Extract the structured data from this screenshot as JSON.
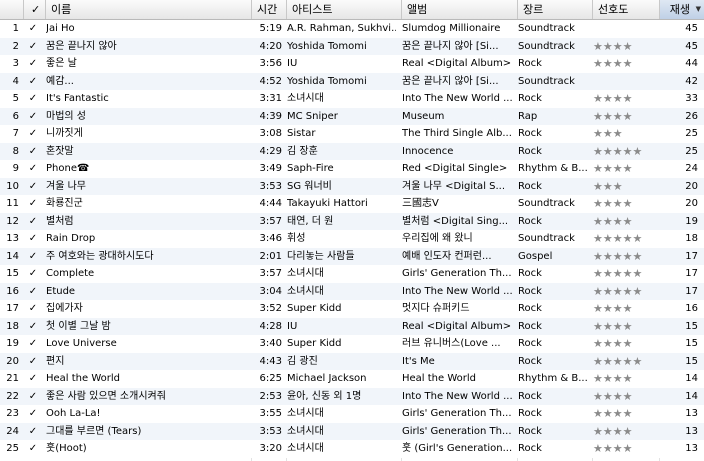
{
  "header": {
    "check": "✓",
    "name": "이름",
    "time": "시간",
    "artist": "아티스트",
    "album": "앨범",
    "genre": "장르",
    "rating": "선호도",
    "plays": "재생",
    "sort_arrow": "▼"
  },
  "check_glyph": "✓",
  "tracks": [
    {
      "num": "1",
      "name": "Jai Ho",
      "time": "5:19",
      "artist": "A.R. Rahman, Sukhvi...",
      "album": "Slumdog Millionaire",
      "genre": "Soundtrack",
      "rating": "",
      "plays": "45"
    },
    {
      "num": "2",
      "name": "꿈은 끝나지 않아",
      "time": "4:20",
      "artist": "Yoshida Tomomi",
      "album": "꿈은 끝나지 않아 [Si...",
      "genre": "Soundtrack",
      "rating": "★★★★",
      "plays": "45"
    },
    {
      "num": "3",
      "name": "좋은 날",
      "time": "3:56",
      "artist": "IU",
      "album": "Real <Digital Album>",
      "genre": "Rock",
      "rating": "★★★★",
      "plays": "44"
    },
    {
      "num": "4",
      "name": "예감...",
      "time": "4:52",
      "artist": "Yoshida Tomomi",
      "album": "꿈은 끝나지 않아 [Si...",
      "genre": "Soundtrack",
      "rating": "",
      "plays": "42"
    },
    {
      "num": "5",
      "name": "It's Fantastic",
      "time": "3:31",
      "artist": "소녀시대",
      "album": "Into The New World ...",
      "genre": "Rock",
      "rating": "★★★★",
      "plays": "33"
    },
    {
      "num": "6",
      "name": "마법의 성",
      "time": "4:39",
      "artist": "MC Sniper",
      "album": "Museum",
      "genre": "Rap",
      "rating": "★★★★",
      "plays": "26"
    },
    {
      "num": "7",
      "name": "니까짓게",
      "time": "3:08",
      "artist": "Sistar",
      "album": "The Third Single Alb...",
      "genre": "Rock",
      "rating": "★★★",
      "plays": "25"
    },
    {
      "num": "8",
      "name": "혼잣말",
      "time": "4:29",
      "artist": "김 장훈",
      "album": "Innocence",
      "genre": "Rock",
      "rating": "★★★★★",
      "plays": "25"
    },
    {
      "num": "9",
      "name": "Phone☎",
      "time": "3:49",
      "artist": "Saph-Fire",
      "album": "Red <Digital Single>",
      "genre": "Rhythm & B...",
      "rating": "★★★★",
      "plays": "24"
    },
    {
      "num": "10",
      "name": "겨울 나무",
      "time": "3:53",
      "artist": "SG 워너비",
      "album": "겨울 나무 <Digital S...",
      "genre": "Rock",
      "rating": "★★★",
      "plays": "20"
    },
    {
      "num": "11",
      "name": "화룡진군",
      "time": "4:44",
      "artist": "Takayuki Hattori",
      "album": "三國志V",
      "genre": "Soundtrack",
      "rating": "★★★★",
      "plays": "20"
    },
    {
      "num": "12",
      "name": "별처럼",
      "time": "3:57",
      "artist": "태연, 더 원",
      "album": "별처럼 <Digital Sing...",
      "genre": "Rock",
      "rating": "★★★★",
      "plays": "19"
    },
    {
      "num": "13",
      "name": "Rain Drop",
      "time": "3:46",
      "artist": "휘성",
      "album": "우리집에 왜 왔니",
      "genre": "Soundtrack",
      "rating": "★★★★★",
      "plays": "18"
    },
    {
      "num": "14",
      "name": "주 여호와는 광대하시도다",
      "time": "2:01",
      "artist": "다리놓는 사람들",
      "album": "예배 인도자 컨퍼런...",
      "genre": "Gospel",
      "rating": "★★★★★",
      "plays": "17"
    },
    {
      "num": "15",
      "name": "Complete",
      "time": "3:57",
      "artist": "소녀시대",
      "album": "Girls' Generation Th...",
      "genre": "Rock",
      "rating": "★★★★★",
      "plays": "17"
    },
    {
      "num": "16",
      "name": "Etude",
      "time": "3:04",
      "artist": "소녀시대",
      "album": "Into The New World ...",
      "genre": "Rock",
      "rating": "★★★★★",
      "plays": "17"
    },
    {
      "num": "17",
      "name": "집에가자",
      "time": "3:52",
      "artist": "Super Kidd",
      "album": "멋지다 슈퍼키드",
      "genre": "Rock",
      "rating": "★★★★",
      "plays": "16"
    },
    {
      "num": "18",
      "name": "첫 이별 그날 밤",
      "time": "4:28",
      "artist": "IU",
      "album": "Real <Digital Album>",
      "genre": "Rock",
      "rating": "★★★★",
      "plays": "15"
    },
    {
      "num": "19",
      "name": "Love Universe",
      "time": "3:40",
      "artist": "Super Kidd",
      "album": "러브 유니버스(Love ...",
      "genre": "Rock",
      "rating": "★★★★",
      "plays": "15"
    },
    {
      "num": "20",
      "name": "편지",
      "time": "4:43",
      "artist": "김 광진",
      "album": "It's Me",
      "genre": "Rock",
      "rating": "★★★★★",
      "plays": "15"
    },
    {
      "num": "21",
      "name": "Heal the World",
      "time": "6:25",
      "artist": "Michael Jackson",
      "album": "Heal the World",
      "genre": "Rhythm & B...",
      "rating": "★★★★",
      "plays": "14"
    },
    {
      "num": "22",
      "name": "좋은 사람 있으면 소개시켜줘",
      "time": "2:53",
      "artist": "윤아, 신동 외 1명",
      "album": "Into The New World ...",
      "genre": "Rock",
      "rating": "★★★★",
      "plays": "14"
    },
    {
      "num": "23",
      "name": "Ooh La-La!",
      "time": "3:55",
      "artist": "소녀시대",
      "album": "Girls' Generation Th...",
      "genre": "Rock",
      "rating": "★★★★",
      "plays": "13"
    },
    {
      "num": "24",
      "name": "그대를 부르면 (Tears)",
      "time": "3:53",
      "artist": "소녀시대",
      "album": "Girls' Generation Th...",
      "genre": "Rock",
      "rating": "★★★★",
      "plays": "13"
    },
    {
      "num": "25",
      "name": "훗(Hoot)",
      "time": "3:20",
      "artist": "소녀시대",
      "album": "훗 (Girl's Generation...",
      "genre": "Rock",
      "rating": "★★★★",
      "plays": "13"
    }
  ]
}
